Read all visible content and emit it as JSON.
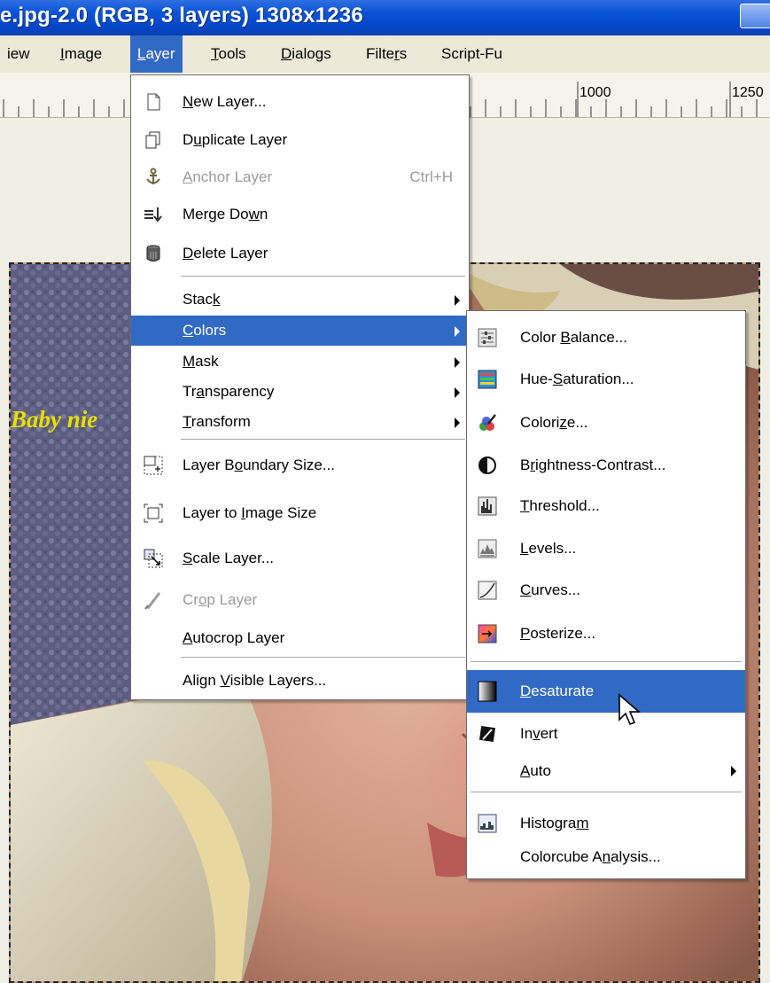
{
  "window": {
    "title": "e.jpg-2.0 (RGB, 3 layers) 1308x1236"
  },
  "menubar": {
    "items": [
      {
        "label": "iew",
        "u": ""
      },
      {
        "label": "Image",
        "pre": "",
        "u": "I",
        "post": "mage"
      },
      {
        "label": "Layer",
        "pre": "",
        "u": "L",
        "post": "ayer"
      },
      {
        "label": "Tools",
        "pre": "",
        "u": "T",
        "post": "ools"
      },
      {
        "label": "Dialogs",
        "pre": "",
        "u": "D",
        "post": "ialogs"
      },
      {
        "label": "Filters",
        "pre": "Filte",
        "u": "r",
        "post": "s"
      },
      {
        "label": "Script-Fu",
        "pre": "Script-Fu",
        "u": "",
        "post": ""
      }
    ],
    "active": "Layer"
  },
  "ruler": {
    "labels": [
      "1000",
      "1250"
    ]
  },
  "image": {
    "caption": "Baby nie"
  },
  "layer_menu": {
    "items": [
      {
        "pre": "",
        "u": "N",
        "post": "ew Layer...",
        "icon": "new-layer-icon"
      },
      {
        "pre": "D",
        "u": "u",
        "post": "plicate Layer",
        "icon": "duplicate-layer-icon"
      },
      {
        "pre": "",
        "u": "A",
        "post": "nchor Layer",
        "shortcut": "Ctrl+H",
        "disabled": true,
        "icon": "anchor-icon"
      },
      {
        "pre": "Merge Do",
        "u": "w",
        "post": "n",
        "icon": "merge-down-icon"
      },
      {
        "pre": "",
        "u": "D",
        "post": "elete Layer",
        "icon": "trash-icon"
      },
      {
        "pre": "Stac",
        "u": "k",
        "post": "",
        "submenu": true
      },
      {
        "pre": "",
        "u": "C",
        "post": "olors",
        "submenu": true,
        "highlight": true
      },
      {
        "pre": "",
        "u": "M",
        "post": "ask",
        "submenu": true
      },
      {
        "pre": "Tr",
        "u": "a",
        "post": "nsparency",
        "submenu": true
      },
      {
        "pre": "",
        "u": "T",
        "post": "ransform",
        "submenu": true
      },
      {
        "pre": "Layer B",
        "u": "o",
        "post": "undary Size...",
        "icon": "layer-boundary-icon"
      },
      {
        "pre": "Layer to ",
        "u": "I",
        "post": "mage Size",
        "icon": "layer-to-image-icon"
      },
      {
        "pre": "",
        "u": "S",
        "post": "cale Layer...",
        "icon": "scale-layer-icon"
      },
      {
        "pre": "Cr",
        "u": "o",
        "post": "p Layer",
        "disabled": true,
        "icon": "crop-icon"
      },
      {
        "pre": "",
        "u": "A",
        "post": "utocrop Layer"
      },
      {
        "pre": "Align ",
        "u": "V",
        "post": "isible Layers..."
      }
    ]
  },
  "colors_menu": {
    "items": [
      {
        "pre": "Color ",
        "u": "B",
        "post": "alance...",
        "icon": "color-balance-icon"
      },
      {
        "pre": "Hue-",
        "u": "S",
        "post": "aturation...",
        "icon": "hue-saturation-icon"
      },
      {
        "pre": "Colori",
        "u": "z",
        "post": "e...",
        "icon": "colorize-icon"
      },
      {
        "pre": "B",
        "u": "r",
        "post": "ightness-Contrast...",
        "icon": "brightness-contrast-icon"
      },
      {
        "pre": "",
        "u": "T",
        "post": "hreshold...",
        "icon": "threshold-icon"
      },
      {
        "pre": "",
        "u": "L",
        "post": "evels...",
        "icon": "levels-icon"
      },
      {
        "pre": "",
        "u": "C",
        "post": "urves...",
        "icon": "curves-icon"
      },
      {
        "pre": "",
        "u": "P",
        "post": "osterize...",
        "icon": "posterize-icon"
      },
      {
        "pre": "",
        "u": "D",
        "post": "esaturate",
        "highlight": true,
        "icon": "desaturate-icon"
      },
      {
        "pre": "In",
        "u": "v",
        "post": "ert",
        "icon": "invert-icon"
      },
      {
        "pre": "",
        "u": "A",
        "post": "uto",
        "submenu": true
      },
      {
        "pre": "Histogra",
        "u": "m",
        "post": "",
        "icon": "histogram-icon"
      },
      {
        "pre": "Colorcube A",
        "u": "n",
        "post": "alysis..."
      }
    ]
  },
  "colors": {
    "highlight": "#316ac5",
    "titlebar": "#0a54d8",
    "caption": "#e7e000"
  }
}
